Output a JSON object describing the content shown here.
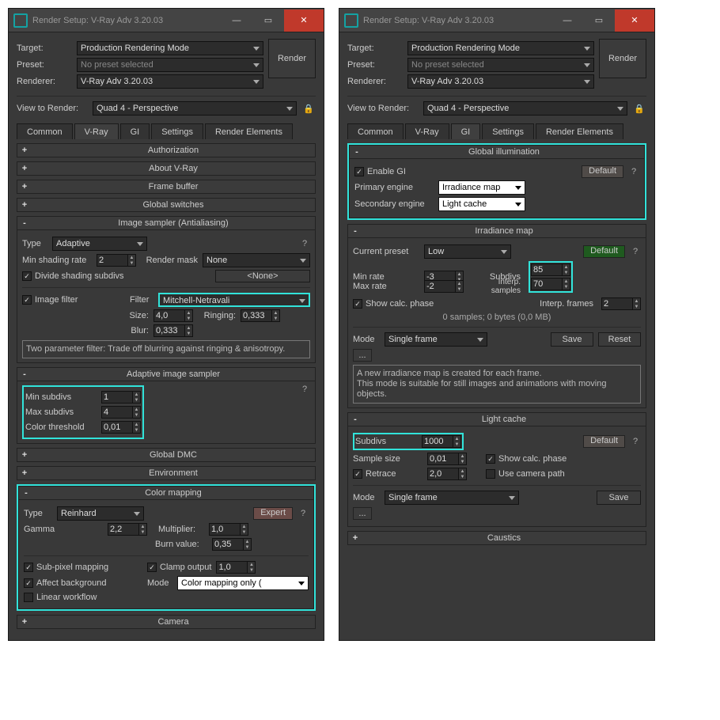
{
  "window": {
    "title": "Render Setup: V-Ray Adv 3.20.03"
  },
  "header": {
    "target_lbl": "Target:",
    "target": "Production Rendering Mode",
    "preset_lbl": "Preset:",
    "preset": "No preset selected",
    "renderer_lbl": "Renderer:",
    "renderer": "V-Ray Adv 3.20.03",
    "render_btn": "Render",
    "view_lbl": "View to Render:",
    "view": "Quad 4 - Perspective"
  },
  "tabs": [
    "Common",
    "V-Ray",
    "GI",
    "Settings",
    "Render Elements"
  ],
  "vray": {
    "rollouts": {
      "auth": "Authorization",
      "about": "About V-Ray",
      "fb": "Frame buffer",
      "gswitch": "Global switches",
      "sampler": "Image sampler (Antialiasing)",
      "ais": "Adaptive image sampler",
      "dmc": "Global DMC",
      "env": "Environment",
      "cmap": "Color mapping",
      "cam": "Camera"
    },
    "sampler": {
      "type_lbl": "Type",
      "type": "Adaptive",
      "msr_lbl": "Min shading rate",
      "msr": "2",
      "mask_lbl": "Render mask",
      "mask": "None",
      "div": "Divide shading subdivs",
      "none": "<None>",
      "filter_chk": "Image filter",
      "filter_lbl": "Filter",
      "filter": "Mitchell-Netravali",
      "size_lbl": "Size:",
      "size": "4,0",
      "ring_lbl": "Ringing:",
      "ring": "0,333",
      "blur_lbl": "Blur:",
      "blur": "0,333",
      "desc": "Two parameter filter: Trade off blurring against ringing & anisotropy."
    },
    "ais": {
      "min_lbl": "Min subdivs",
      "min": "1",
      "max_lbl": "Max subdivs",
      "max": "4",
      "ct_lbl": "Color threshold",
      "ct": "0,01"
    },
    "cmap": {
      "type_lbl": "Type",
      "type": "Reinhard",
      "expert": "Expert",
      "gamma_lbl": "Gamma",
      "gamma": "2,2",
      "mult_lbl": "Multiplier:",
      "mult": "1,0",
      "bv_lbl": "Burn value:",
      "bv": "0,35",
      "spm": "Sub-pixel mapping",
      "clamp": "Clamp output",
      "clamp_v": "1,0",
      "ab": "Affect background",
      "mode_lbl": "Mode",
      "mode": "Color mapping only (",
      "lw": "Linear workflow"
    }
  },
  "gi": {
    "rollouts": {
      "gi": "Global illumination",
      "im": "Irradiance map",
      "lc": "Light cache",
      "caus": "Caustics"
    },
    "global": {
      "enable": "Enable GI",
      "default": "Default",
      "pe_lbl": "Primary engine",
      "pe": "Irradiance map",
      "se_lbl": "Secondary engine",
      "se": "Light cache"
    },
    "im": {
      "preset_lbl": "Current preset",
      "preset": "Low",
      "default": "Default",
      "minr_lbl": "Min rate",
      "minr": "-3",
      "maxr_lbl": "Max rate",
      "maxr": "-2",
      "sub_lbl": "Subdivs",
      "sub": "85",
      "is_lbl": "Interp. samples",
      "is": "70",
      "scp": "Show calc. phase",
      "if_lbl": "Interp. frames",
      "if": "2",
      "info": "0 samples; 0 bytes (0,0 MB)",
      "mode_lbl": "Mode",
      "mode": "Single frame",
      "save": "Save",
      "reset": "Reset",
      "msg": "A new irradiance map is created for each frame.\nThis mode is suitable for still images and animations with moving objects."
    },
    "lc": {
      "sub_lbl": "Subdivs",
      "sub": "1000",
      "default": "Default",
      "ss_lbl": "Sample size",
      "ss": "0,01",
      "scp": "Show calc. phase",
      "rt": "Retrace",
      "rt_v": "2,0",
      "ucp": "Use camera path",
      "mode_lbl": "Mode",
      "mode": "Single frame",
      "save": "Save"
    }
  }
}
